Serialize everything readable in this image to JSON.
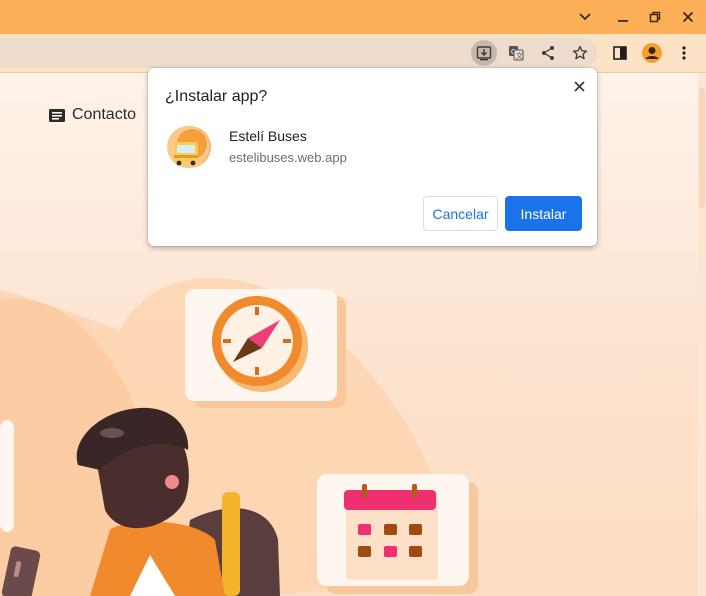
{
  "window": {
    "minimize_icon": "minimize-icon",
    "maximize_icon": "restore-icon",
    "close_icon": "close-icon",
    "tab_search_icon": "chevron-down-icon"
  },
  "toolbar": {
    "icons": [
      "install-app-icon",
      "translate-icon",
      "share-icon",
      "bookmark-star-icon",
      "side-panel-icon",
      "profile-icon",
      "more-menu-icon"
    ]
  },
  "page": {
    "nav_contact_label": "Contacto"
  },
  "install_dialog": {
    "title": "¿Instalar app?",
    "app_name": "Estelí Buses",
    "app_url": "estelibuses.web.app",
    "cancel_label": "Cancelar",
    "install_label": "Instalar"
  },
  "colors": {
    "titlebar": "#fdaf58",
    "accent_blue": "#1a73e8",
    "illustration_orange": "#f08a2c"
  }
}
